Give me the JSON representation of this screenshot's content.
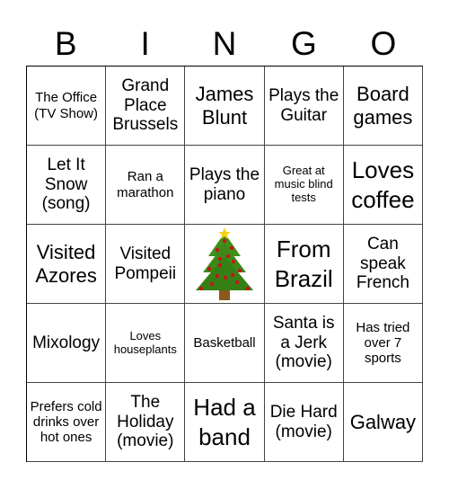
{
  "header": {
    "letters": [
      "B",
      "I",
      "N",
      "G",
      "O"
    ]
  },
  "cells": [
    {
      "text": "The Office (TV Show)",
      "size": "s-s"
    },
    {
      "text": "Grand Place Brussels",
      "size": "s-l"
    },
    {
      "text": "James Blunt",
      "size": "s-xl"
    },
    {
      "text": "Plays the Guitar",
      "size": "s-l"
    },
    {
      "text": "Board games",
      "size": "s-xl"
    },
    {
      "text": "Let It Snow (song)",
      "size": "s-l"
    },
    {
      "text": "Ran a marathon",
      "size": "s-s"
    },
    {
      "text": "Plays the piano",
      "size": "s-l"
    },
    {
      "text": "Great at music blind tests",
      "size": "s-xs"
    },
    {
      "text": "Loves coffee",
      "size": "s-xxl"
    },
    {
      "text": "Visited Azores",
      "size": "s-xl"
    },
    {
      "text": "Visited Pompeii",
      "size": "s-l"
    },
    {
      "text": "",
      "size": "free",
      "icon": "christmas-tree-icon"
    },
    {
      "text": "From Brazil",
      "size": "s-xxl"
    },
    {
      "text": "Can speak French",
      "size": "s-l"
    },
    {
      "text": "Mixology",
      "size": "s-l"
    },
    {
      "text": "Loves houseplants",
      "size": "s-xs"
    },
    {
      "text": "Basketball",
      "size": "s-s"
    },
    {
      "text": "Santa is a Jerk (movie)",
      "size": "s-l"
    },
    {
      "text": "Has tried over 7 sports",
      "size": "s-s"
    },
    {
      "text": "Prefers cold drinks over hot ones",
      "size": "s-s"
    },
    {
      "text": "The Holiday (movie)",
      "size": "s-l"
    },
    {
      "text": "Had a band",
      "size": "s-xxl"
    },
    {
      "text": "Die Hard (movie)",
      "size": "s-l"
    },
    {
      "text": "Galway",
      "size": "s-xl"
    }
  ]
}
